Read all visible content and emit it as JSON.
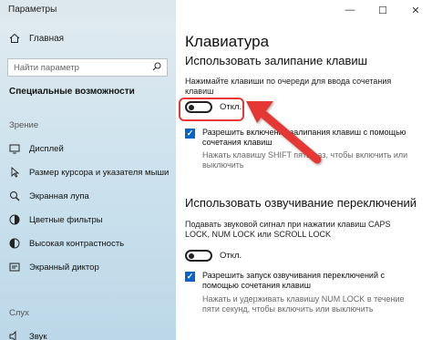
{
  "window": {
    "title": "Параметры",
    "minimize": "—",
    "maximize": "☐",
    "close": "✕"
  },
  "sidebar": {
    "home_label": "Главная",
    "search_placeholder": "Найти параметр",
    "section_title": "Специальные возможности",
    "group_vision": "Зрение",
    "items": [
      {
        "label": "Дисплей",
        "icon": "display-icon"
      },
      {
        "label": "Размер курсора и указателя мыши",
        "icon": "cursor-icon"
      },
      {
        "label": "Экранная лупа",
        "icon": "magnifier-icon"
      },
      {
        "label": "Цветные фильтры",
        "icon": "color-filter-icon"
      },
      {
        "label": "Высокая контрастность",
        "icon": "contrast-icon"
      },
      {
        "label": "Экранный диктор",
        "icon": "narrator-icon"
      }
    ],
    "group_hearing": "Слух",
    "partial_item": "Звук"
  },
  "main": {
    "title": "Клавиатура",
    "sticky": {
      "heading": "Использовать залипание клавиш",
      "description": "Нажимайте клавиши по очереди для ввода сочетания клавиш",
      "toggle_state": "Откл.",
      "checkbox_label": "Разрешить включение залипания клавиш с помощью сочетания клавиш",
      "checkbox_hint": "Нажать клавишу SHIFT пять раз, чтобы включить или выключить"
    },
    "toggle_keys": {
      "heading": "Использовать озвучивание переключений",
      "description": "Подавать звуковой сигнал при нажатии клавиш CAPS LOCK, NUM LOCK или SCROLL LOCK",
      "toggle_state": "Откл.",
      "checkbox_label": "Разрешить запуск озвучивания переключений с помощью сочетания клавиш",
      "checkbox_hint": "Нажать и удерживать клавишу NUM LOCK в течение пяти секунд, чтобы включить или выключить"
    }
  },
  "colors": {
    "accent": "#0a64c8",
    "highlight": "#e53935"
  }
}
